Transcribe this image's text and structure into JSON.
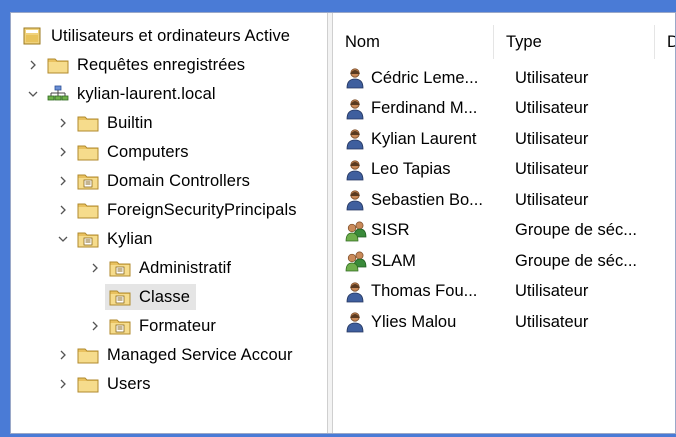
{
  "tree": {
    "root_label": "Utilisateurs et ordinateurs Active",
    "saved_queries_label": "Requêtes enregistrées",
    "domain_label": "kylian-laurent.local",
    "builtin_label": "Builtin",
    "computers_label": "Computers",
    "domain_controllers_label": "Domain Controllers",
    "foreign_label": "ForeignSecurityPrincipals",
    "kylian_label": "Kylian",
    "administratif_label": "Administratif",
    "classe_label": "Classe",
    "formateur_label": "Formateur",
    "msa_label": "Managed Service Accour",
    "users_label": "Users"
  },
  "list": {
    "col_name": "Nom",
    "col_type": "Type",
    "col_desc": "D",
    "rows": [
      {
        "name": "Cédric Leme...",
        "type": "Utilisateur",
        "icon": "user-icon"
      },
      {
        "name": "Ferdinand M...",
        "type": "Utilisateur",
        "icon": "user-icon"
      },
      {
        "name": "Kylian Laurent",
        "type": "Utilisateur",
        "icon": "user-icon"
      },
      {
        "name": "Leo Tapias",
        "type": "Utilisateur",
        "icon": "user-icon"
      },
      {
        "name": "Sebastien Bo...",
        "type": "Utilisateur",
        "icon": "user-icon"
      },
      {
        "name": "SISR",
        "type": "Groupe de séc...",
        "icon": "group-icon"
      },
      {
        "name": "SLAM",
        "type": "Groupe de séc...",
        "icon": "group-icon"
      },
      {
        "name": "Thomas Fou...",
        "type": "Utilisateur",
        "icon": "user-icon"
      },
      {
        "name": "Ylies Malou",
        "type": "Utilisateur",
        "icon": "user-icon"
      }
    ]
  },
  "colors": {
    "frame_background": "#4a7bd6",
    "folder": "#f2d27a",
    "selection": "#e5e5e5"
  }
}
